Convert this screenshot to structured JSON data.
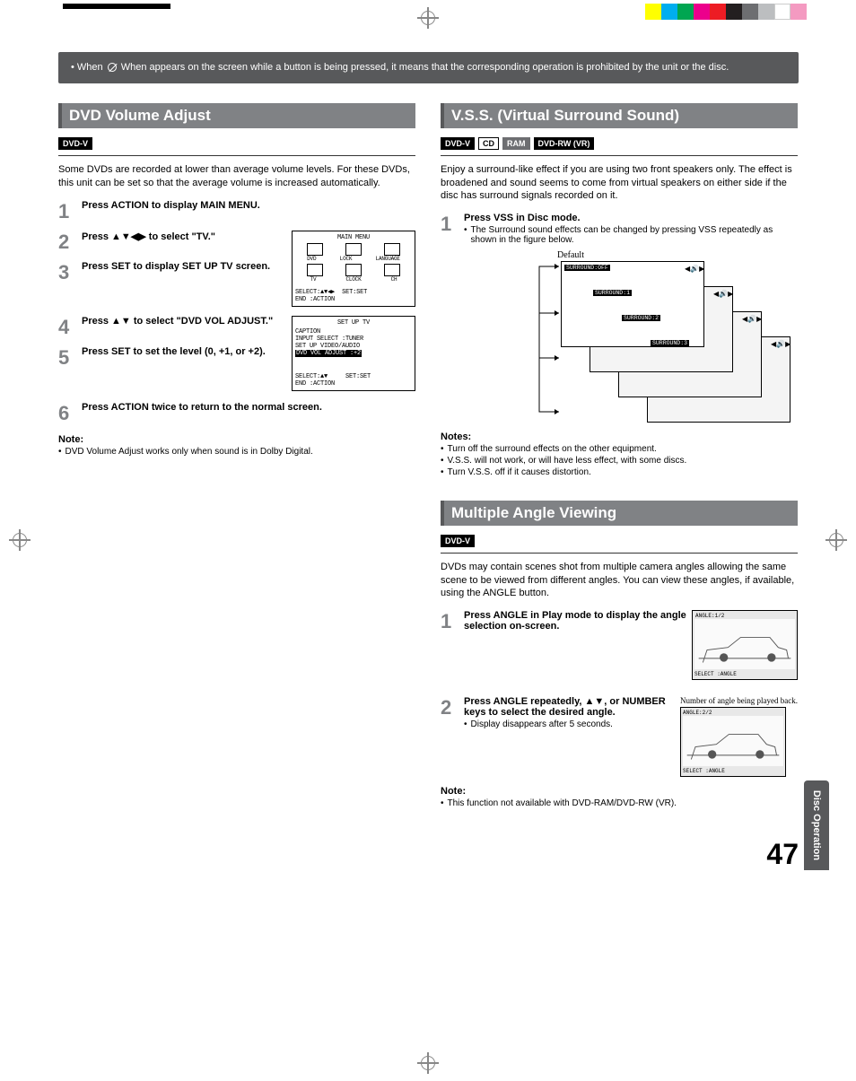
{
  "callout": {
    "text": "When appears on the screen while a button is being pressed, it means that the corresponding operation is prohibited by the unit or the disc."
  },
  "left": {
    "section1": {
      "title": "DVD Volume Adjust",
      "badges": [
        "DVD-V"
      ],
      "intro": "Some DVDs are recorded at lower than average volume levels. For these DVDs, this unit can be set so that the average volume is increased automatically.",
      "steps": {
        "s1": "Press ACTION to display MAIN MENU.",
        "s2": "Press ▲▼◀▶ to select \"TV.\"",
        "s3": "Press SET to display SET UP TV screen.",
        "s4": "Press ▲▼ to select \"DVD VOL ADJUST.\"",
        "s5": "Press SET to set the level (0, +1, or +2).",
        "s6": "Press ACTION twice to return to the normal screen."
      },
      "note_h": "Note:",
      "note1": "DVD Volume Adjust works only when sound is in Dolby Digital.",
      "osd1": {
        "title": "MAIN MENU",
        "lbl1": "DVD",
        "lbl2": "LOCK",
        "lbl3": "LANGUAGE",
        "lbl4": "TV",
        "lbl5": "CLOCK",
        "lbl6": "CH",
        "foot1": "SELECT:▲▼◀▶",
        "foot2": "SET:SET",
        "foot3": "END   :ACTION"
      },
      "osd2": {
        "title": "SET UP TV",
        "l1": "CAPTION",
        "l2": "INPUT SELECT   :TUNER",
        "l3": "SET UP VIDEO/AUDIO",
        "l4": "DVD VOL ADJUST :+2",
        "foot1": "SELECT:▲▼",
        "foot2": "SET:SET",
        "foot3": "END   :ACTION"
      }
    }
  },
  "right": {
    "vss": {
      "title": "V.S.S. (Virtual Surround Sound)",
      "badges": [
        "DVD-V",
        "CD",
        "RAM",
        "DVD-RW (VR)"
      ],
      "intro": "Enjoy a surround-like effect if you are using two front speakers only. The effect is broadened and sound seems to come from virtual speakers on either side if the disc has surround signals recorded on it.",
      "s1": "Press VSS in Disc mode.",
      "s1sub": "The Surround sound effects can be changed by pressing VSS repeatedly as shown in the figure below.",
      "diag": {
        "default": "Default",
        "b1": "SURROUND:OFF",
        "b2": "SURROUND:1",
        "b3": "SURROUND:2",
        "b4": "SURROUND:3"
      },
      "notes_h": "Notes:",
      "n1": "Turn off the surround effects on the other equipment.",
      "n2": "V.S.S. will not work, or will have less effect, with some discs.",
      "n3": "Turn V.S.S. off if it causes distortion."
    },
    "angle": {
      "title": "Multiple Angle Viewing",
      "badges": [
        "DVD-V"
      ],
      "intro": "DVDs may contain scenes shot from multiple camera angles allowing the same scene to be viewed from different angles. You can view these angles, if available, using the ANGLE button.",
      "s1": "Press ANGLE in Play mode to display the angle selection on-screen.",
      "s2": "Press ANGLE repeatedly, ▲▼, or NUMBER keys to select the desired angle.",
      "s2sub": "Display disappears after 5 seconds.",
      "note_h": "Note:",
      "n1": "This function not available with DVD-RAM/DVD-RW (VR).",
      "diag": {
        "cap": "Number of angle being played back.",
        "a1": "ANGLE:1/2",
        "sel1": "SELECT :ANGLE",
        "a2": "ANGLE:2/2",
        "sel2": "SELECT :ANGLE"
      }
    }
  },
  "sidetab": "Disc Operation",
  "pagenum": "47",
  "chart_data": null
}
